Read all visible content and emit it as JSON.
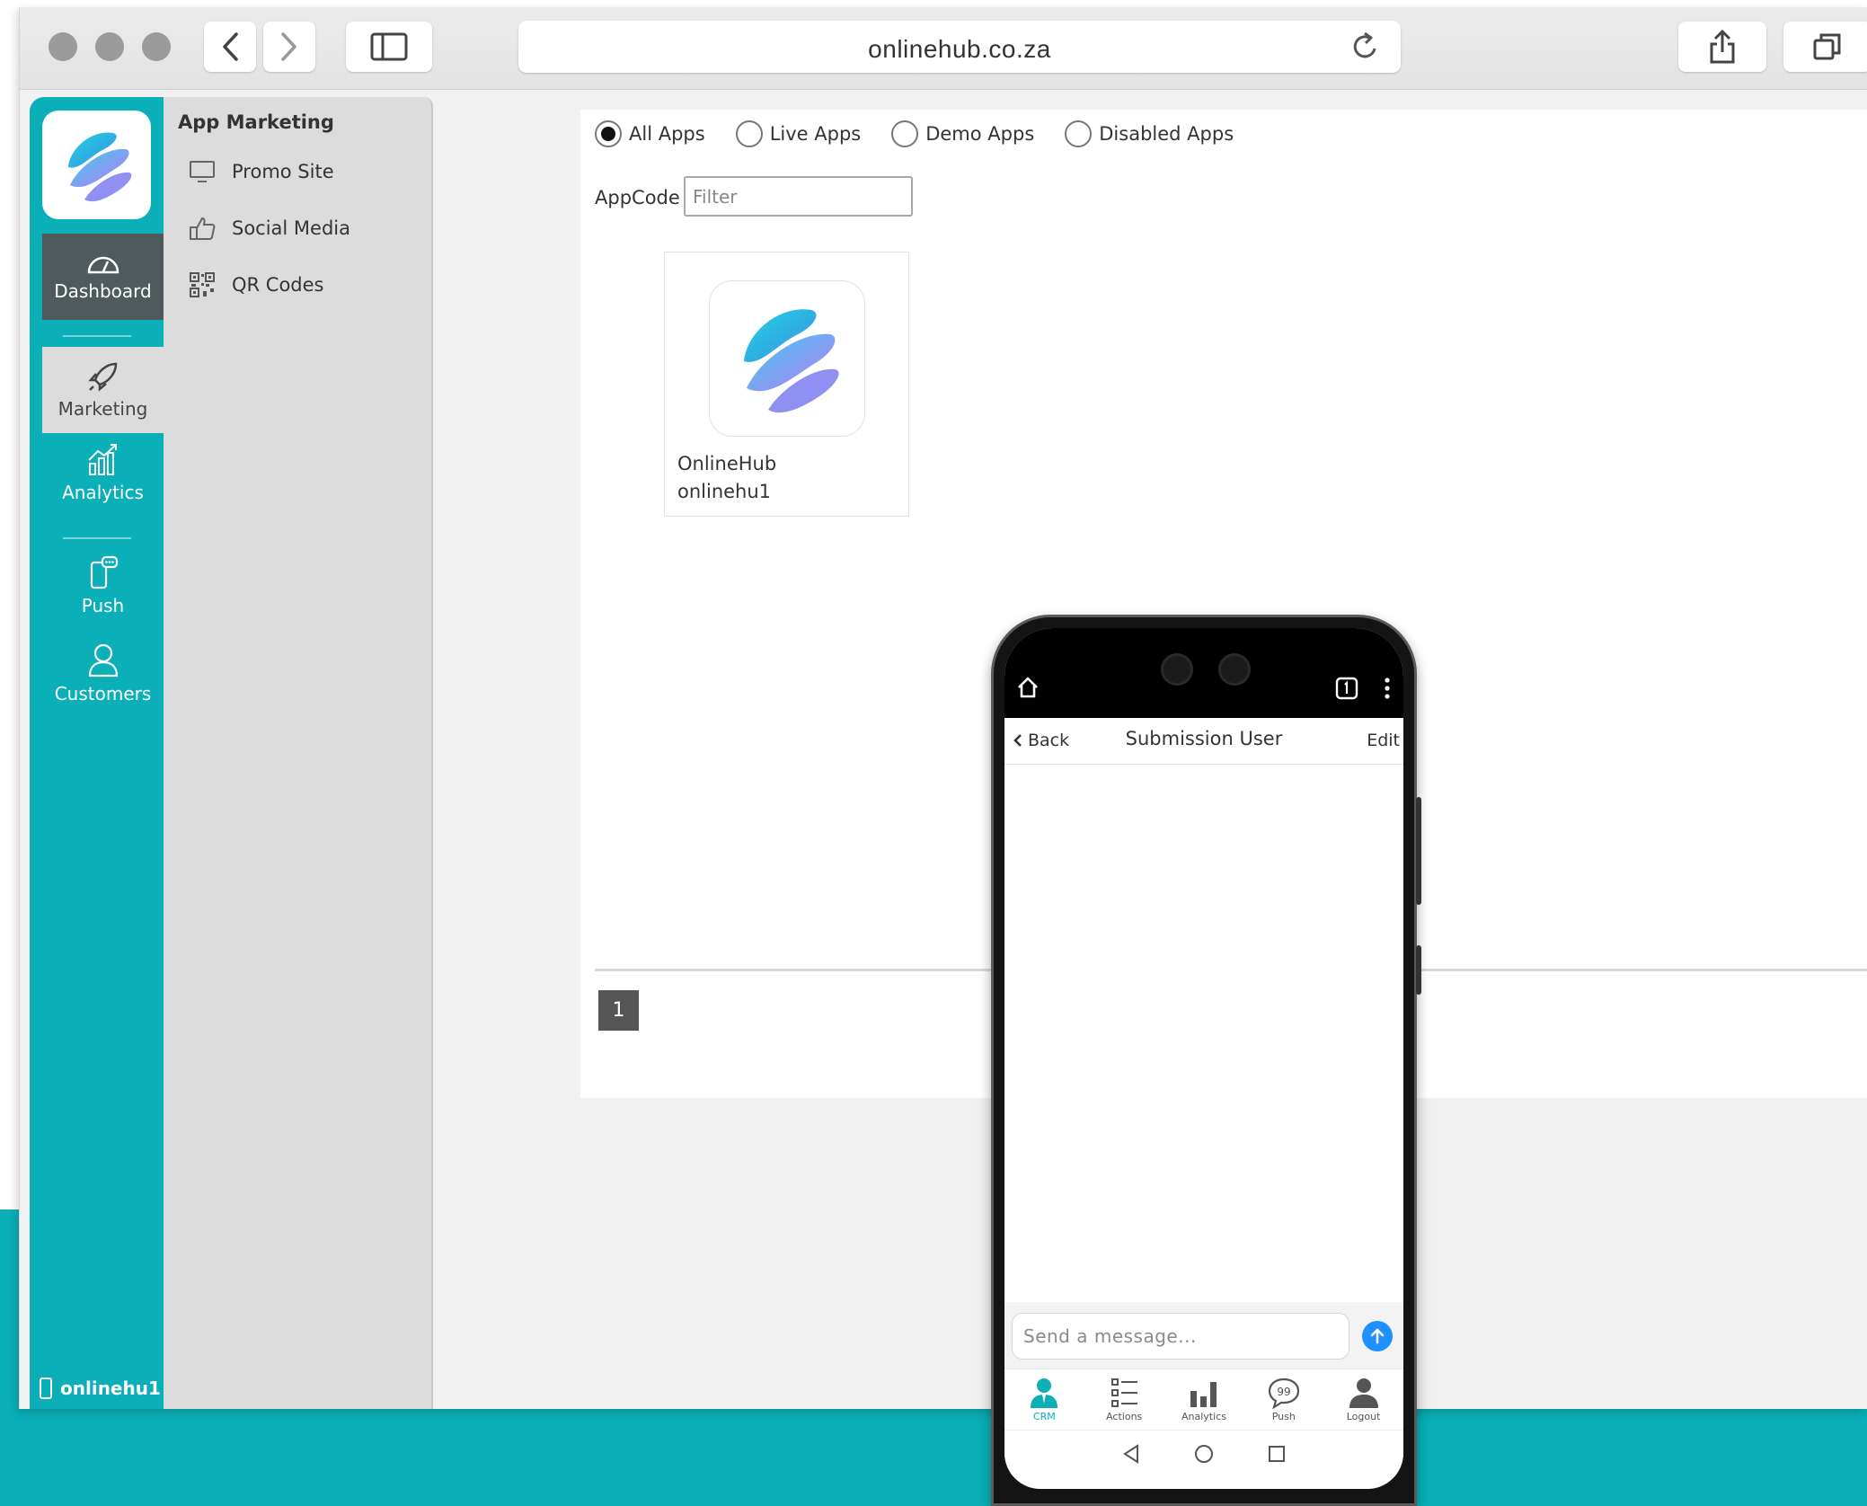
{
  "browser": {
    "url": "onlinehub.co.za"
  },
  "rail": {
    "items": [
      {
        "label": "Dashboard"
      },
      {
        "label": "Marketing"
      },
      {
        "label": "Analytics"
      },
      {
        "label": "Push"
      },
      {
        "label": "Customers"
      }
    ],
    "user": "onlinehu1"
  },
  "submenu": {
    "title": "App Marketing",
    "items": [
      {
        "label": "Promo Site"
      },
      {
        "label": "Social Media"
      },
      {
        "label": "QR Codes"
      }
    ]
  },
  "filters": {
    "options": [
      {
        "label": "All Apps",
        "selected": true
      },
      {
        "label": "Live Apps",
        "selected": false
      },
      {
        "label": "Demo Apps",
        "selected": false
      },
      {
        "label": "Disabled Apps",
        "selected": false
      }
    ],
    "appcode_label": "AppCode",
    "appcode_placeholder": "Filter"
  },
  "apps": [
    {
      "name": "OnlineHub",
      "code": "onlinehu1"
    }
  ],
  "pagination": {
    "current": "1"
  },
  "phone": {
    "back": "Back",
    "title": "Submission User",
    "edit": "Edit",
    "message_placeholder": "Send a message...",
    "tabs": [
      {
        "label": "CRM",
        "icon": "crm-user-icon"
      },
      {
        "label": "Actions",
        "icon": "list-icon"
      },
      {
        "label": "Analytics",
        "icon": "bar-chart-icon"
      },
      {
        "label": "Push",
        "icon": "chat-bubble-icon"
      },
      {
        "label": "Logout",
        "icon": "person-icon"
      }
    ]
  },
  "colors": {
    "brand_teal": "#0aafb7",
    "dashboard_active": "#4e5a5c",
    "send_blue": "#1e90ff"
  }
}
